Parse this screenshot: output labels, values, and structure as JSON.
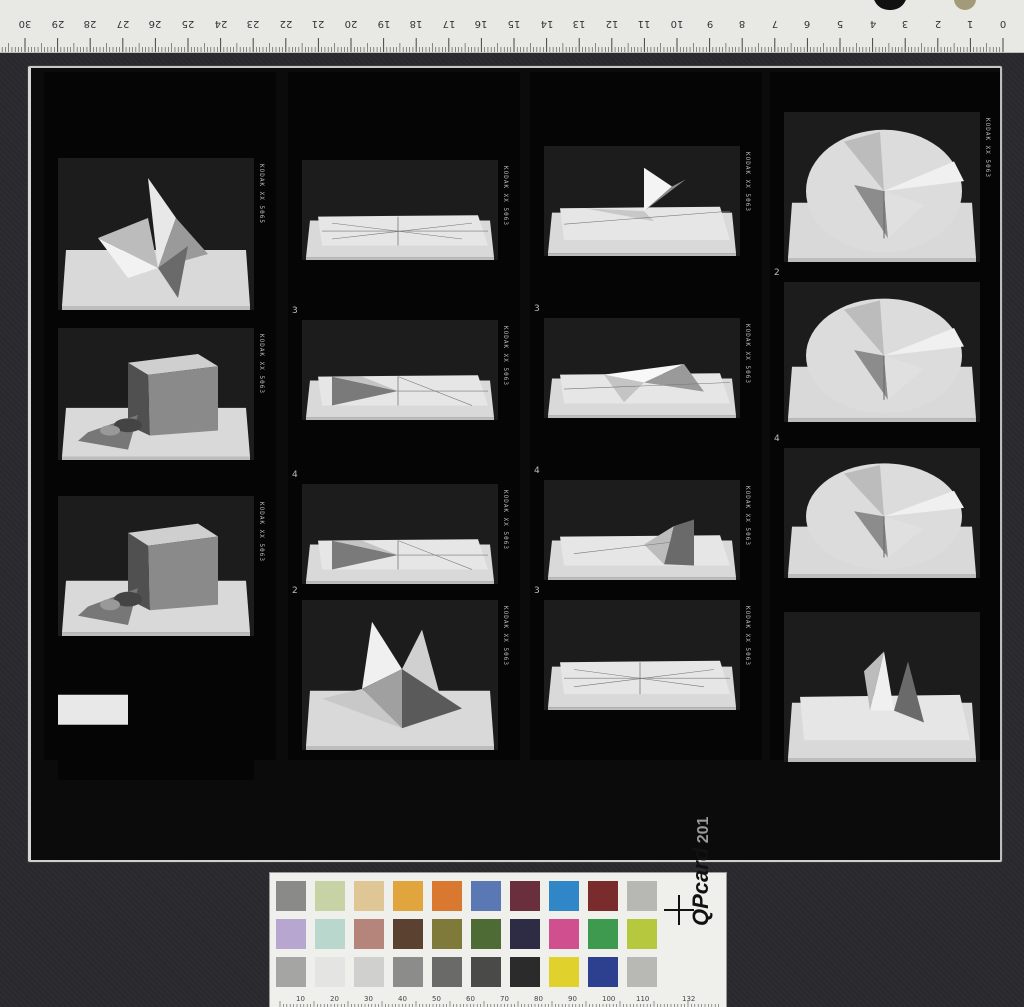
{
  "ruler": {
    "numbers": [
      "30",
      "29",
      "28",
      "27",
      "26",
      "25",
      "24",
      "23",
      "22",
      "21",
      "20",
      "19",
      "18",
      "17",
      "16",
      "15",
      "14",
      "13",
      "12",
      "11",
      "10",
      "9",
      "8",
      "7",
      "6",
      "5",
      "4",
      "3",
      "2",
      "1",
      "0"
    ]
  },
  "contact_sheet": {
    "edge_texts": [
      "KODAK XX 5065",
      "KODAK XX 5063",
      "KODAK XX 5063",
      "KODAK XX 5063",
      "KODAK XX 5063",
      "KODAK XX 5063",
      "KODAK XX 5063",
      "KODAK XX 5063",
      "KODAK XX 5063",
      "KODAK XX 5063",
      "KODAK XX 5063",
      "KODAK XX 5063"
    ],
    "frame_marks": [
      "3",
      "4",
      "2",
      "3",
      "4",
      "3",
      "2",
      "4"
    ]
  },
  "color_card": {
    "brand": "QPcard",
    "model": "201",
    "scale_labels": [
      "10",
      "20",
      "30",
      "40",
      "50",
      "60",
      "70",
      "80",
      "90",
      "100",
      "110",
      "132"
    ],
    "patches_row1": [
      "#8a8a88",
      "#c7d3a5",
      "#dec795",
      "#e0a53c",
      "#d9792f",
      "#5a79b4",
      "#6a2f3d",
      "#2f87c8",
      "#7a2b2b",
      "#b7b7b3"
    ],
    "patches_row2": [
      "#b7a6cf",
      "#b9d7cc",
      "#b5847a",
      "#5b4130",
      "#7f7a3a",
      "#4e6a35",
      "#2e2b45",
      "#d04f8e",
      "#3e9a4f",
      "#b6c83e"
    ],
    "patches_row3": [
      "#a5a5a3",
      "#e4e4e2",
      "#d0d0ce",
      "#8c8c8a",
      "#6a6a68",
      "#4a4a49",
      "#2b2b2b",
      "#e0d12c",
      "#2d3f8f",
      "#b8b8b5"
    ]
  }
}
